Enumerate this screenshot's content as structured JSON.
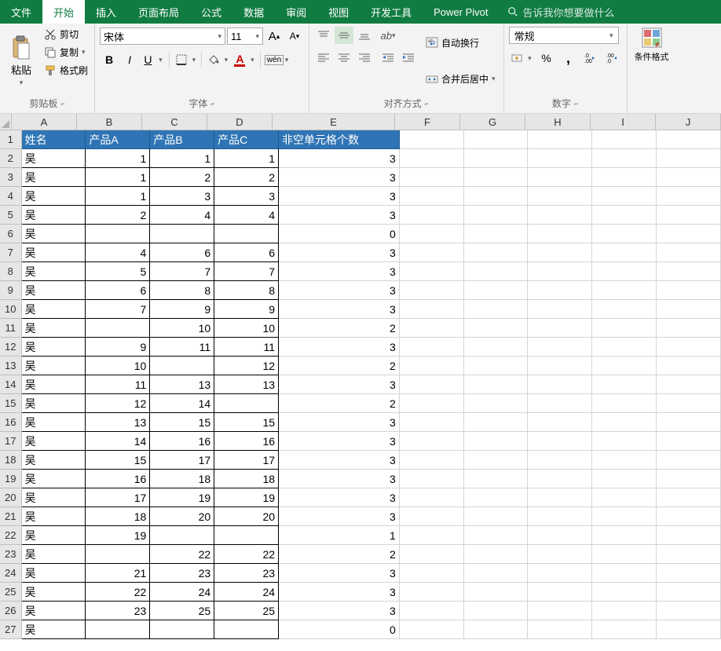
{
  "menu": {
    "tabs": [
      "文件",
      "开始",
      "插入",
      "页面布局",
      "公式",
      "数据",
      "审阅",
      "视图",
      "开发工具",
      "Power Pivot"
    ],
    "active_index": 1,
    "search_placeholder": "告诉我你想要做什么"
  },
  "ribbon": {
    "clipboard": {
      "label": "剪贴板",
      "paste": "粘贴",
      "cut": "剪切",
      "copy": "复制",
      "painter": "格式刷"
    },
    "font": {
      "label": "字体",
      "name": "宋体",
      "size": "11",
      "bold": "B",
      "italic": "I",
      "underline": "U",
      "ruby": "wén"
    },
    "align": {
      "label": "对齐方式",
      "wrap": "自动换行",
      "merge": "合并后居中"
    },
    "number": {
      "label": "数字",
      "format": "常规",
      "percent": "%",
      "comma": ","
    },
    "cond": {
      "label": "条件格式"
    }
  },
  "grid": {
    "columns": [
      "A",
      "B",
      "C",
      "D",
      "E",
      "F",
      "G",
      "H",
      "I",
      "J"
    ],
    "headers": {
      "A": "姓名",
      "B": "产品A",
      "C": "产品B",
      "D": "产品C",
      "E": "非空单元格个数"
    },
    "rows": [
      {
        "A": "吴",
        "B": "1",
        "C": "1",
        "D": "1",
        "E": "3"
      },
      {
        "A": "吴",
        "B": "1",
        "C": "2",
        "D": "2",
        "E": "3"
      },
      {
        "A": "吴",
        "B": "1",
        "C": "3",
        "D": "3",
        "E": "3"
      },
      {
        "A": "吴",
        "B": "2",
        "C": "4",
        "D": "4",
        "E": "3"
      },
      {
        "A": "吴",
        "B": "",
        "C": "",
        "D": "",
        "E": "0"
      },
      {
        "A": "吴",
        "B": "4",
        "C": "6",
        "D": "6",
        "E": "3"
      },
      {
        "A": "吴",
        "B": "5",
        "C": "7",
        "D": "7",
        "E": "3"
      },
      {
        "A": "吴",
        "B": "6",
        "C": "8",
        "D": "8",
        "E": "3"
      },
      {
        "A": "吴",
        "B": "7",
        "C": "9",
        "D": "9",
        "E": "3"
      },
      {
        "A": "吴",
        "B": "",
        "C": "10",
        "D": "10",
        "E": "2"
      },
      {
        "A": "吴",
        "B": "9",
        "C": "11",
        "D": "11",
        "E": "3"
      },
      {
        "A": "吴",
        "B": "10",
        "C": "",
        "D": "12",
        "E": "2"
      },
      {
        "A": "吴",
        "B": "11",
        "C": "13",
        "D": "13",
        "E": "3"
      },
      {
        "A": "吴",
        "B": "12",
        "C": "14",
        "D": "",
        "E": "2"
      },
      {
        "A": "吴",
        "B": "13",
        "C": "15",
        "D": "15",
        "E": "3"
      },
      {
        "A": "吴",
        "B": "14",
        "C": "16",
        "D": "16",
        "E": "3"
      },
      {
        "A": "吴",
        "B": "15",
        "C": "17",
        "D": "17",
        "E": "3"
      },
      {
        "A": "吴",
        "B": "16",
        "C": "18",
        "D": "18",
        "E": "3"
      },
      {
        "A": "吴",
        "B": "17",
        "C": "19",
        "D": "19",
        "E": "3"
      },
      {
        "A": "吴",
        "B": "18",
        "C": "20",
        "D": "20",
        "E": "3"
      },
      {
        "A": "吴",
        "B": "19",
        "C": "",
        "D": "",
        "E": "1"
      },
      {
        "A": "吴",
        "B": "",
        "C": "22",
        "D": "22",
        "E": "2"
      },
      {
        "A": "吴",
        "B": "21",
        "C": "23",
        "D": "23",
        "E": "3"
      },
      {
        "A": "吴",
        "B": "22",
        "C": "24",
        "D": "24",
        "E": "3"
      },
      {
        "A": "吴",
        "B": "23",
        "C": "25",
        "D": "25",
        "E": "3"
      },
      {
        "A": "吴",
        "B": "",
        "C": "",
        "D": "",
        "E": "0"
      }
    ]
  }
}
